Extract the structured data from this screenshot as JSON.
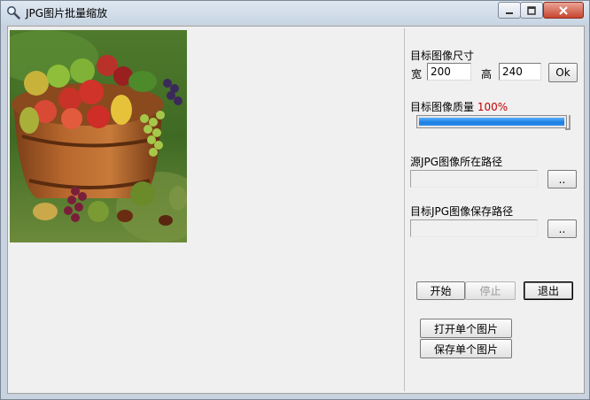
{
  "window": {
    "title": "JPG图片批量缩放"
  },
  "image_preview": {
    "icon": "fruit-basket-photo"
  },
  "target_size": {
    "heading": "目标图像尺寸",
    "width_label": "宽",
    "width_value": "200",
    "height_label": "高",
    "height_value": "240",
    "ok_label": "Ok"
  },
  "quality": {
    "heading": "目标图像质量",
    "value_text": "100%",
    "value_percent": 100
  },
  "source_path": {
    "heading": "源JPG图像所在路径",
    "value": "",
    "browse_label": ".."
  },
  "save_path": {
    "heading": "目标JPG图像保存路径",
    "value": "",
    "browse_label": ".."
  },
  "actions": {
    "start_label": "开始",
    "stop_label": "停止",
    "exit_label": "退出",
    "open_single_label": "打开单个图片",
    "save_single_label": "保存单个图片"
  },
  "colors": {
    "progress": "#1c7fe0",
    "quality_text": "#c00000"
  }
}
